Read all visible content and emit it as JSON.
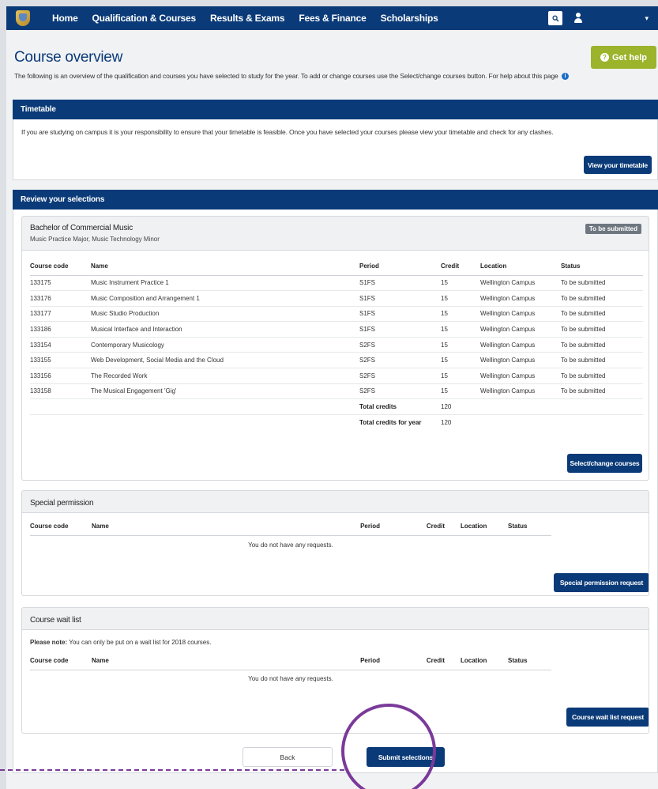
{
  "nav": {
    "items": [
      "Home",
      "Qualification & Courses",
      "Results & Exams",
      "Fees & Finance",
      "Scholarships"
    ],
    "caret": "▾"
  },
  "header": {
    "title": "Course overview",
    "intro": "The following is an overview of the qualification and courses you have selected to study for the year. To add or change courses use the Select/change courses button. For help about this page",
    "help_label": "Get help"
  },
  "timetable": {
    "heading": "Timetable",
    "text": "If you are studying on campus it is your responsibility to ensure that your timetable is feasible. Once you have selected your courses please view your timetable and check for any clashes.",
    "button": "View your timetable"
  },
  "review": {
    "heading": "Review your selections",
    "qualification": "Bachelor of Commercial Music",
    "majors": "Music Practice Major, Music Technology Minor",
    "badge": "To be submitted",
    "columns": [
      "Course code",
      "Name",
      "Period",
      "Credit",
      "Location",
      "Status"
    ],
    "rows": [
      [
        "133175",
        "Music Instrument Practice 1",
        "S1FS",
        "15",
        "Wellington Campus",
        "To be submitted"
      ],
      [
        "133176",
        "Music Composition and Arrangement 1",
        "S1FS",
        "15",
        "Wellington Campus",
        "To be submitted"
      ],
      [
        "133177",
        "Music Studio Production",
        "S1FS",
        "15",
        "Wellington Campus",
        "To be submitted"
      ],
      [
        "133186",
        "Musical Interface and Interaction",
        "S1FS",
        "15",
        "Wellington Campus",
        "To be submitted"
      ],
      [
        "133154",
        "Contemporary Musicology",
        "S2FS",
        "15",
        "Wellington Campus",
        "To be submitted"
      ],
      [
        "133155",
        "Web Development, Social Media and the Cloud",
        "S2FS",
        "15",
        "Wellington Campus",
        "To be submitted"
      ],
      [
        "133156",
        "The Recorded Work",
        "S2FS",
        "15",
        "Wellington Campus",
        "To be submitted"
      ],
      [
        "133158",
        "The Musical Engagement 'Gig'",
        "S2FS",
        "15",
        "Wellington Campus",
        "To be submitted"
      ]
    ],
    "total_label": "Total credits",
    "total_value": "120",
    "total_year_label": "Total credits for year",
    "total_year_value": "120",
    "button": "Select/change courses"
  },
  "special": {
    "title": "Special permission",
    "columns": [
      "Course code",
      "Name",
      "Period",
      "Credit",
      "Location",
      "Status"
    ],
    "empty": "You do not have any requests.",
    "button": "Special permission request"
  },
  "waitlist": {
    "title": "Course wait list",
    "note_bold": "Please note:",
    "note_text": " You can only be put on a wait list for 2018 courses.",
    "columns": [
      "Course code",
      "Name",
      "Period",
      "Credit",
      "Location",
      "Status"
    ],
    "empty": "You do not have any requests.",
    "button": "Course wait list request"
  },
  "footer": {
    "back": "Back",
    "submit": "Submit selections"
  },
  "colors": {
    "brand": "#0a3a78",
    "help": "#9cb32c",
    "annotation": "#7a3a9a"
  }
}
